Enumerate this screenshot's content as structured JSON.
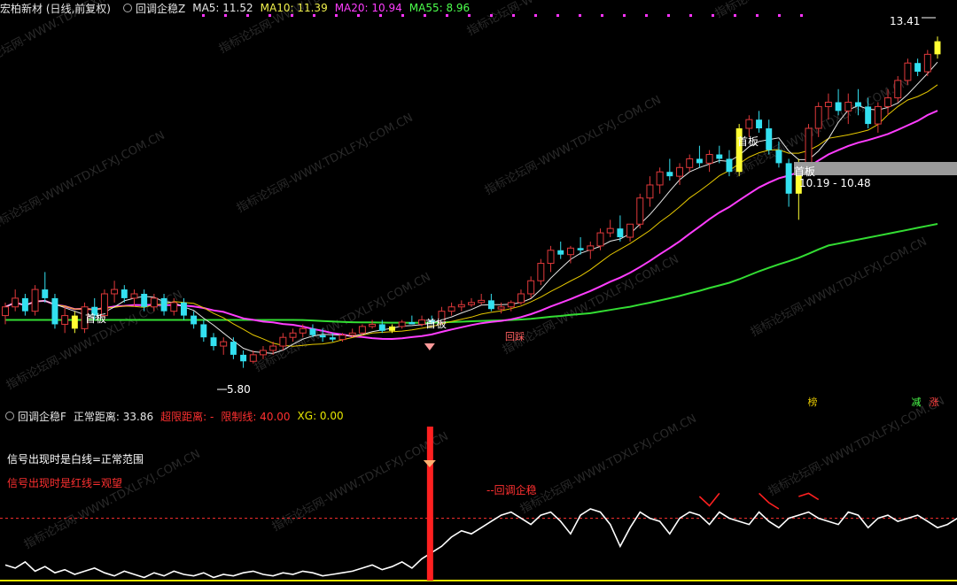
{
  "header": {
    "stock": "宏柏新材 (日线,前复权)",
    "indicator": "回调企稳Z",
    "ma": [
      {
        "label": "MA5: 11.52",
        "color": "#e6e6e6"
      },
      {
        "label": "MA10: 11.39",
        "color": "#f1f14d"
      },
      {
        "label": "MA20: 10.94",
        "color": "#ff3dff"
      },
      {
        "label": "MA55: 8.96",
        "color": "#4cff4c"
      }
    ]
  },
  "sub_header": {
    "indicator": "回调企稳F",
    "normal": "正常距离: 33.86",
    "over": "超限距离: -",
    "limit": "限制线: 40.00",
    "xg": "XG: 0.00"
  },
  "notes": {
    "white_line": "信号出现时是白线=正常范围",
    "red_line": "信号出现时是红线=观望",
    "signal": "--回调企稳",
    "high_price": "13.41",
    "low_price": "5.80",
    "range": "10.19 - 10.48",
    "first_board_1": "首板",
    "first_board_2": "首板",
    "first_board_3": "首板",
    "first_board_4": "首板",
    "pos_tag": "回踩",
    "flag_bang": "榜",
    "flag_jian": "减",
    "flag_zhang": "涨"
  },
  "watermark": "指标论坛网-WWW.TDXLFXJ.COM.CN",
  "colors": {
    "up": "#e0393b",
    "down": "#33e0f0",
    "board": "#ffff33",
    "ma5": "#e6e6e6",
    "ma10": "#e6c800",
    "ma20": "#ff3dff",
    "ma55": "#33dd33",
    "signal": "#ff2020",
    "limit": "#ff3030",
    "line": "#ffffff",
    "xg": "#e6e600"
  },
  "chart_data": {
    "type": "candlestick",
    "price_range": [
      5.0,
      13.8
    ],
    "marks": {
      "high": 13.41,
      "low": 5.8,
      "range": [
        10.19,
        10.48
      ]
    },
    "candles": [
      [
        7.0,
        7.3,
        6.8,
        7.2
      ],
      [
        7.2,
        7.6,
        7.1,
        7.4
      ],
      [
        7.4,
        7.5,
        7.0,
        7.1
      ],
      [
        7.1,
        7.7,
        7.0,
        7.6
      ],
      [
        7.6,
        8.0,
        7.3,
        7.4
      ],
      [
        7.4,
        7.5,
        6.7,
        6.8
      ],
      [
        6.8,
        7.2,
        6.6,
        7.0
      ],
      [
        7.0,
        7.1,
        6.6,
        6.7
      ],
      [
        6.7,
        7.3,
        6.6,
        7.2
      ],
      [
        7.2,
        7.4,
        6.9,
        7.0
      ],
      [
        7.0,
        7.6,
        6.9,
        7.5
      ],
      [
        7.5,
        7.8,
        7.3,
        7.6
      ],
      [
        7.6,
        7.7,
        7.3,
        7.4
      ],
      [
        7.4,
        7.6,
        7.2,
        7.5
      ],
      [
        7.5,
        7.6,
        7.1,
        7.2
      ],
      [
        7.2,
        7.5,
        7.1,
        7.4
      ],
      [
        7.4,
        7.5,
        7.0,
        7.1
      ],
      [
        7.1,
        7.4,
        7.0,
        7.3
      ],
      [
        7.3,
        7.4,
        6.9,
        7.0
      ],
      [
        7.0,
        7.1,
        6.7,
        6.8
      ],
      [
        6.8,
        6.9,
        6.4,
        6.5
      ],
      [
        6.5,
        6.6,
        6.2,
        6.3
      ],
      [
        6.3,
        6.5,
        6.1,
        6.4
      ],
      [
        6.4,
        6.5,
        6.0,
        6.1
      ],
      [
        6.1,
        6.2,
        5.8,
        5.95
      ],
      [
        5.95,
        6.2,
        5.9,
        6.1
      ],
      [
        6.1,
        6.3,
        6.0,
        6.2
      ],
      [
        6.2,
        6.4,
        6.1,
        6.3
      ],
      [
        6.3,
        6.6,
        6.2,
        6.5
      ],
      [
        6.5,
        6.7,
        6.4,
        6.6
      ],
      [
        6.6,
        6.8,
        6.5,
        6.7
      ],
      [
        6.7,
        6.8,
        6.5,
        6.55
      ],
      [
        6.55,
        6.7,
        6.4,
        6.5
      ],
      [
        6.5,
        6.6,
        6.4,
        6.45
      ],
      [
        6.45,
        6.6,
        6.4,
        6.55
      ],
      [
        6.55,
        6.7,
        6.5,
        6.6
      ],
      [
        6.6,
        6.8,
        6.55,
        6.75
      ],
      [
        6.75,
        6.9,
        6.7,
        6.8
      ],
      [
        6.8,
        6.9,
        6.6,
        6.65
      ],
      [
        6.65,
        6.8,
        6.6,
        6.75
      ],
      [
        6.75,
        6.9,
        6.7,
        6.85
      ],
      [
        6.85,
        7.0,
        6.8,
        6.8
      ],
      [
        6.8,
        7.0,
        6.75,
        6.9
      ],
      [
        6.9,
        7.0,
        6.8,
        6.85
      ],
      [
        6.85,
        7.2,
        6.8,
        7.1
      ],
      [
        7.1,
        7.3,
        7.0,
        7.2
      ],
      [
        7.2,
        7.35,
        7.1,
        7.25
      ],
      [
        7.25,
        7.4,
        7.2,
        7.3
      ],
      [
        7.3,
        7.5,
        7.25,
        7.35
      ],
      [
        7.35,
        7.5,
        7.1,
        7.15
      ],
      [
        7.15,
        7.3,
        7.05,
        7.2
      ],
      [
        7.2,
        7.35,
        7.1,
        7.3
      ],
      [
        7.3,
        7.6,
        7.25,
        7.5
      ],
      [
        7.5,
        7.9,
        7.4,
        7.8
      ],
      [
        7.8,
        8.3,
        7.7,
        8.2
      ],
      [
        8.2,
        8.6,
        8.0,
        8.5
      ],
      [
        8.5,
        8.7,
        8.3,
        8.4
      ],
      [
        8.4,
        8.6,
        8.2,
        8.55
      ],
      [
        8.55,
        8.8,
        8.4,
        8.5
      ],
      [
        8.5,
        8.7,
        8.3,
        8.6
      ],
      [
        8.6,
        9.0,
        8.5,
        8.9
      ],
      [
        8.9,
        9.2,
        8.8,
        9.0
      ],
      [
        9.0,
        9.3,
        8.7,
        8.8
      ],
      [
        8.8,
        9.1,
        8.7,
        9.1
      ],
      [
        9.1,
        9.8,
        9.0,
        9.7
      ],
      [
        9.7,
        10.2,
        9.5,
        10.0
      ],
      [
        10.0,
        10.4,
        9.8,
        10.3
      ],
      [
        10.3,
        10.6,
        10.1,
        10.2
      ],
      [
        10.2,
        10.5,
        10.0,
        10.4
      ],
      [
        10.4,
        10.7,
        10.3,
        10.6
      ],
      [
        10.6,
        10.9,
        10.4,
        10.5
      ],
      [
        10.5,
        10.8,
        10.3,
        10.7
      ],
      [
        10.7,
        10.9,
        10.5,
        10.6
      ],
      [
        10.6,
        10.8,
        10.2,
        10.3
      ],
      [
        10.3,
        11.4,
        10.2,
        11.3
      ],
      [
        11.3,
        11.6,
        11.1,
        11.5
      ],
      [
        11.5,
        11.7,
        11.2,
        11.3
      ],
      [
        11.3,
        11.5,
        10.7,
        10.8
      ],
      [
        10.8,
        11.0,
        10.4,
        10.5
      ],
      [
        10.5,
        10.6,
        9.5,
        9.8
      ],
      [
        9.8,
        10.6,
        9.2,
        10.5
      ],
      [
        10.5,
        11.4,
        10.4,
        11.3
      ],
      [
        11.3,
        11.9,
        11.1,
        11.8
      ],
      [
        11.8,
        12.1,
        11.5,
        11.9
      ],
      [
        11.9,
        12.2,
        11.6,
        11.7
      ],
      [
        11.7,
        12.1,
        11.4,
        11.9
      ],
      [
        11.9,
        12.2,
        11.6,
        11.8
      ],
      [
        11.8,
        12.0,
        11.3,
        11.4
      ],
      [
        11.4,
        11.9,
        11.2,
        11.8
      ],
      [
        11.8,
        12.2,
        11.6,
        12.0
      ],
      [
        12.0,
        12.5,
        11.9,
        12.4
      ],
      [
        12.4,
        12.9,
        12.3,
        12.8
      ],
      [
        12.8,
        12.9,
        12.5,
        12.6
      ],
      [
        12.6,
        13.1,
        12.5,
        13.0
      ],
      [
        13.0,
        13.41,
        12.9,
        13.3
      ]
    ],
    "board_days": [
      7,
      39,
      74,
      80,
      94
    ],
    "sub_panel": {
      "type": "line",
      "y_range": [
        0,
        100
      ],
      "limit_line": 40.0,
      "normal_distance": 33.86,
      "signal_index": 41,
      "values": [
        10,
        8,
        12,
        6,
        9,
        5,
        7,
        4,
        6,
        8,
        5,
        3,
        6,
        4,
        2,
        5,
        3,
        6,
        4,
        3,
        5,
        2,
        4,
        3,
        5,
        6,
        4,
        3,
        5,
        4,
        6,
        5,
        3,
        4,
        5,
        6,
        8,
        10,
        7,
        9,
        12,
        8,
        14,
        18,
        22,
        28,
        32,
        30,
        34,
        38,
        42,
        44,
        40,
        36,
        42,
        44,
        38,
        30,
        42,
        46,
        44,
        36,
        22,
        34,
        44,
        40,
        38,
        30,
        40,
        44,
        42,
        36,
        44,
        40,
        38,
        36,
        44,
        38,
        34,
        40,
        42,
        44,
        40,
        38,
        36,
        44,
        42,
        34,
        40,
        42,
        38,
        40,
        42,
        38,
        34,
        36,
        40,
        38,
        36,
        34
      ],
      "red_segments": [
        [
          70,
          72
        ],
        [
          76,
          78
        ],
        [
          80,
          82
        ]
      ]
    }
  }
}
